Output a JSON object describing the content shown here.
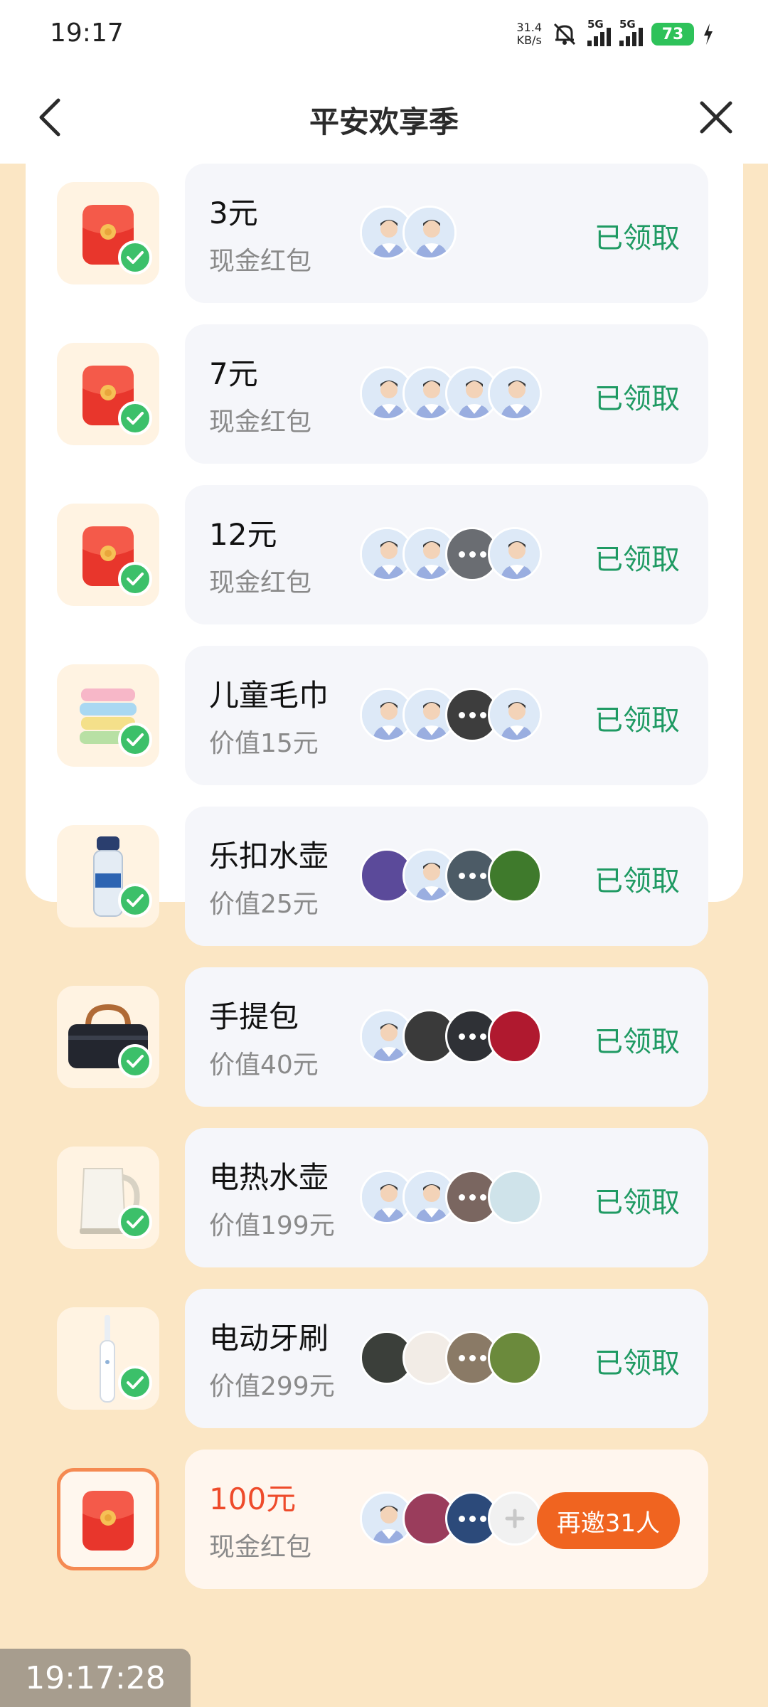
{
  "status_bar": {
    "time": "19:17",
    "net_speed_value": "31.4",
    "net_speed_unit": "KB/s",
    "signal1_label": "5G",
    "signal2_label": "5G",
    "battery": "73"
  },
  "header": {
    "title": "平安欢享季"
  },
  "colors": {
    "claimed_green": "#1f9a63",
    "accent_orange": "#f06420",
    "red_text": "#ee4b2b",
    "page_bg": "#fbe6c4"
  },
  "rewards": [
    {
      "name": "3元",
      "sub": "现金红包",
      "icon": "red-envelope-icon",
      "status": "已领取"
    },
    {
      "name": "7元",
      "sub": "现金红包",
      "icon": "red-envelope-icon",
      "status": "已领取"
    },
    {
      "name": "12元",
      "sub": "现金红包",
      "icon": "red-envelope-icon",
      "status": "已领取"
    },
    {
      "name": "儿童毛巾",
      "sub": "价值15元",
      "icon": "towel-icon",
      "status": "已领取"
    },
    {
      "name": "乐扣水壶",
      "sub": "价值25元",
      "icon": "water-bottle-icon",
      "status": "已领取"
    },
    {
      "name": "手提包",
      "sub": "价值40元",
      "icon": "handbag-icon",
      "status": "已领取"
    },
    {
      "name": "电热水壶",
      "sub": "价值199元",
      "icon": "electric-kettle-icon",
      "status": "已领取"
    },
    {
      "name": "电动牙刷",
      "sub": "价值299元",
      "icon": "electric-toothbrush-icon",
      "status": "已领取"
    }
  ],
  "pending_reward": {
    "name": "100元",
    "sub": "现金红包",
    "icon": "red-envelope-icon",
    "invite_label": "再邀31人"
  },
  "footer": {
    "timestamp": "19:17:28"
  }
}
